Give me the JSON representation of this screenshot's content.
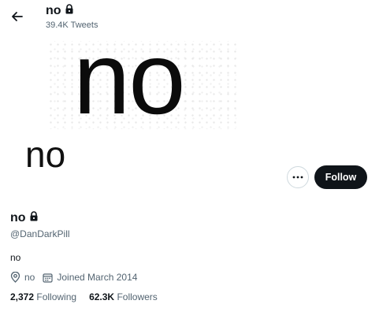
{
  "header": {
    "name": "no",
    "tweet_count": "39.4K Tweets"
  },
  "banner": {
    "text": "no"
  },
  "avatar": {
    "text": "no"
  },
  "actions": {
    "follow_label": "Follow",
    "more_label": "···"
  },
  "profile": {
    "display_name": "no",
    "handle": "@DanDarkPill",
    "bio": "no",
    "location": "no",
    "joined": "Joined March 2014",
    "following_count": "2,372",
    "following_label": "Following",
    "followers_count": "62.3K",
    "followers_label": "Followers"
  },
  "icons": {
    "back": "arrow-left-icon",
    "lock": "lock-icon",
    "location": "location-pin-icon",
    "calendar": "calendar-icon"
  }
}
